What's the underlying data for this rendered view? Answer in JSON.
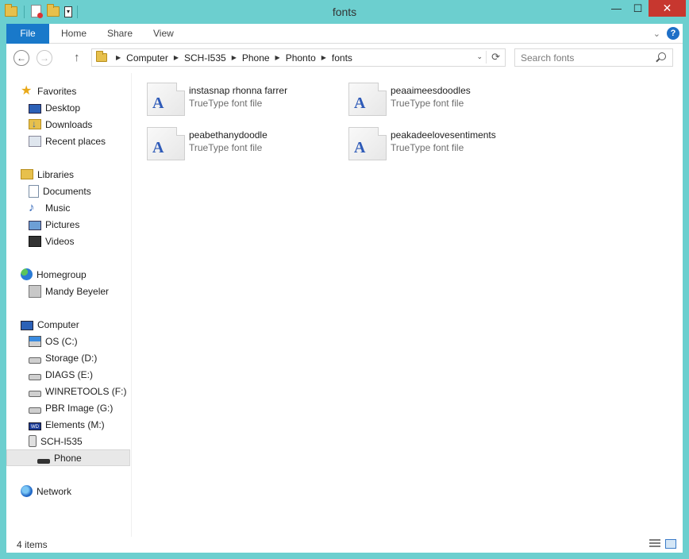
{
  "window": {
    "title": "fonts",
    "minimize_glyph": "—",
    "maximize_glyph": "☐",
    "close_glyph": "✕"
  },
  "ribbon": {
    "tabs": [
      "File",
      "Home",
      "Share",
      "View"
    ],
    "help_glyph": "?",
    "expand_glyph": "⌄"
  },
  "navigation": {
    "back_glyph": "←",
    "forward_glyph": "→",
    "up_glyph": "↑",
    "refresh_glyph": "⟳",
    "dropdown_glyph": "⌄",
    "breadcrumb": [
      "Computer",
      "SCH-I535",
      "Phone",
      "Phonto",
      "fonts"
    ],
    "crumb_separator": "▶",
    "search_placeholder": "Search fonts"
  },
  "sidebar": {
    "favorites": {
      "label": "Favorites",
      "items": [
        "Desktop",
        "Downloads",
        "Recent places"
      ]
    },
    "libraries": {
      "label": "Libraries",
      "items": [
        "Documents",
        "Music",
        "Pictures",
        "Videos"
      ]
    },
    "homegroup": {
      "label": "Homegroup",
      "items": [
        "Mandy Beyeler"
      ]
    },
    "computer": {
      "label": "Computer",
      "items": [
        "OS (C:)",
        "Storage (D:)",
        "DIAGS (E:)",
        "WINRETOOLS (F:)",
        "PBR Image (G:)",
        "Elements (M:)",
        "SCH-I535",
        "Phone"
      ]
    },
    "network": {
      "label": "Network"
    },
    "selected": "Phone"
  },
  "files": [
    {
      "name": "instasnap rhonna farrer",
      "type": "TrueType font file",
      "icon": "A"
    },
    {
      "name": "peaaimeesdoodles",
      "type": "TrueType font file",
      "icon": "A"
    },
    {
      "name": "peabethanydoodle",
      "type": "TrueType font file",
      "icon": "A"
    },
    {
      "name": "peakadeelovesentiments",
      "type": "TrueType font file",
      "icon": "A"
    }
  ],
  "status": {
    "item_count": "4 items"
  },
  "colors": {
    "window_frame": "#6ccfcf",
    "file_tab": "#1979ca",
    "close_button": "#c7372f",
    "font_icon_letter": "#2f5bb8"
  }
}
